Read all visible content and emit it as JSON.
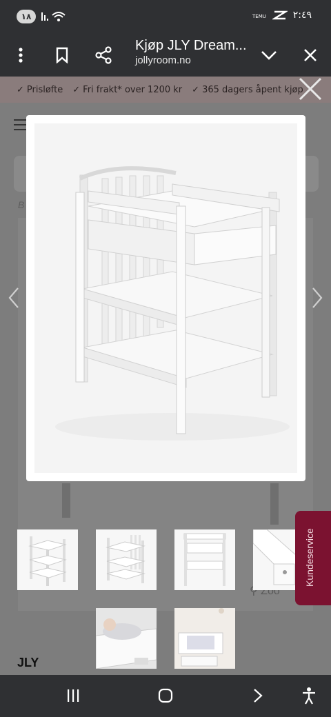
{
  "status_bar": {
    "notification_count": "١٨",
    "time": "٢:٤٩",
    "wifi_label": "TEMU"
  },
  "toolbar": {
    "title": "Kjøp JLY Dream...",
    "url": "jollyroom.no",
    "icons": [
      "more-vert-icon",
      "bookmark-icon",
      "share-icon",
      "chevron-down-icon",
      "close-icon"
    ]
  },
  "usp_bar": {
    "items": [
      "Prisløfte",
      "Fri frakt* over 1200 kr",
      "365 dagers åpent kjøp"
    ]
  },
  "page": {
    "breadcrumb_initial": "B",
    "zoom_hint": "Zoo",
    "brand": "JLY"
  },
  "chat_tab": {
    "label": "Kundeservice"
  },
  "colors": {
    "toolbar_bg": "#2f3033",
    "overlay_bg": "#7d7d7d",
    "chat_tab_bg": "#7b1230",
    "modal_bg": "#ffffff"
  },
  "gallery": {
    "thumbnail_count": 6
  }
}
